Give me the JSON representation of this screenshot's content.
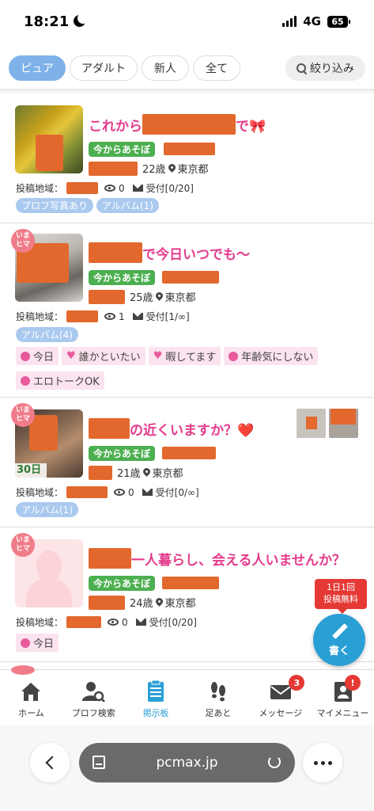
{
  "status": {
    "time": "18:21",
    "network": "4G",
    "battery": "65"
  },
  "filters": {
    "tabs": [
      {
        "label": "ピュア",
        "active": true
      },
      {
        "label": "アダルト",
        "active": false
      },
      {
        "label": "新人",
        "active": false
      },
      {
        "label": "全て",
        "active": false
      }
    ],
    "refine_label": "絞り込み"
  },
  "posts": [
    {
      "title_prefix": "これから",
      "title_suffix": "で🎀",
      "tag": "今からあそぼ",
      "age": "22歳",
      "location": "東京都",
      "area_label": "投稿地域：",
      "views": "0",
      "received": "受付[0/20]",
      "pills": [
        "プロフ写真あり",
        "アルバム(1)"
      ],
      "tags": []
    },
    {
      "badge": "いま\nヒマ",
      "title_suffix": "で今日いつでも～",
      "tag": "今からあそぼ",
      "age": "25歳",
      "location": "東京都",
      "area_label": "投稿地域：",
      "views": "1",
      "received": "受付[1/∞]",
      "pills": [
        "アルバム(4)"
      ],
      "tags": [
        "今日",
        "誰かといたい",
        "暇してます",
        "年齢気にしない",
        "エロトークOK"
      ]
    },
    {
      "badge": "いま\nヒマ",
      "title_suffix": "の近くいますか？❤️",
      "tag": "今からあそぼ",
      "age": "21歳",
      "location": "東京都",
      "area_label": "投稿地域：",
      "views": "0",
      "received": "受付[0/∞]",
      "pills": [
        "アルバム(1)"
      ],
      "thumb_badge": "30日",
      "tags": []
    },
    {
      "badge": "いま\nヒマ",
      "title_suffix": "一人暮らし、会える人いませんか？",
      "tag": "今からあそぼ",
      "age": "24歳",
      "location": "東京都",
      "area_label": "投稿地域：",
      "views": "0",
      "received": "受付[0/20]",
      "pills": [],
      "tags": [
        "今日"
      ]
    }
  ],
  "fab": {
    "note": "1日1回\n投稿無料",
    "label": "書く"
  },
  "nav": [
    {
      "label": "ホーム",
      "icon": "home-icon"
    },
    {
      "label": "プロフ検索",
      "icon": "profile-search-icon"
    },
    {
      "label": "掲示板",
      "icon": "board-icon",
      "active": true
    },
    {
      "label": "足あと",
      "icon": "footprints-icon"
    },
    {
      "label": "メッセージ",
      "icon": "mail-icon",
      "badge": "3"
    },
    {
      "label": "マイメニュー",
      "icon": "my-menu-icon",
      "badge": "!"
    }
  ],
  "browser": {
    "url": "pcmax.jp"
  },
  "colors": {
    "title_pink": "#e33c8c",
    "tag_green": "#4caf50",
    "pill_blue": "#aac9ef",
    "chip_active": "#7fb2e8",
    "mask_orange": "#e2682d",
    "fab_blue": "#2a9fd6",
    "badge_red": "#e53935"
  }
}
